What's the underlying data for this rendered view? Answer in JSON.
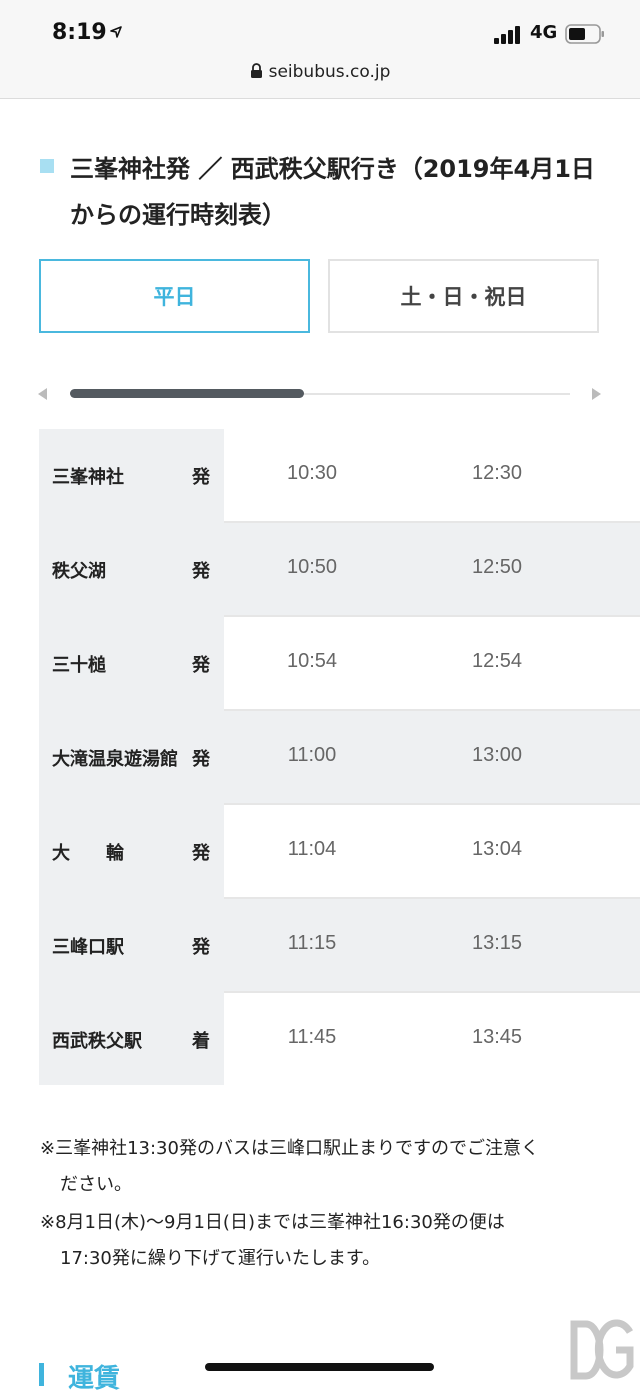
{
  "status_bar": {
    "time": "8:19",
    "network": "4G"
  },
  "browser": {
    "url": "seibubus.co.jp"
  },
  "heading": {
    "title": "三峯神社発 ／ 西武秩父駅行き（2019年4月1日からの運行時刻表）"
  },
  "tabs": [
    {
      "label": "平日",
      "active": true
    },
    {
      "label": "土・日・祝日",
      "active": false
    }
  ],
  "timetable": {
    "rows": [
      {
        "stop": "三峯神社",
        "direction": "発",
        "times": [
          "10:30",
          "12:30"
        ]
      },
      {
        "stop": "秩父湖",
        "direction": "発",
        "times": [
          "10:50",
          "12:50"
        ]
      },
      {
        "stop": "三十槌",
        "direction": "発",
        "times": [
          "10:54",
          "12:54"
        ]
      },
      {
        "stop": "大滝温泉遊湯館",
        "direction": "発",
        "times": [
          "11:00",
          "13:00"
        ]
      },
      {
        "stop": "大　　輪",
        "direction": "発",
        "times": [
          "11:04",
          "13:04"
        ]
      },
      {
        "stop": "三峰口駅",
        "direction": "発",
        "times": [
          "11:15",
          "13:15"
        ]
      },
      {
        "stop": "西武秩父駅",
        "direction": "着",
        "times": [
          "11:45",
          "13:45"
        ]
      }
    ]
  },
  "notes": [
    {
      "line1": "※三峯神社13:30発のバスは三峰口駅止まりですのでご注意く",
      "line2": "ださい。"
    },
    {
      "line1": "※8月1日(木)〜9月1日(日)までは三峯神社16:30発の便は",
      "line2": "17:30発に繰り下げて運行いたします。"
    }
  ],
  "next_section": {
    "heading": "運賃"
  },
  "colors": {
    "accent": "#3fb4dd",
    "marker": "#a8dff2",
    "stop_bg": "#eef0f2"
  },
  "icons": {
    "location": "location-arrow-icon",
    "lock": "lock-icon",
    "logo": "dg-logo"
  }
}
